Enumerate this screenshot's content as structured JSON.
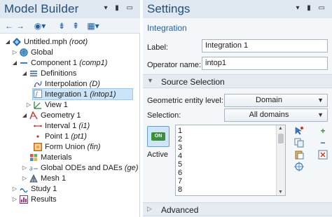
{
  "model_builder": {
    "title": "Model Builder",
    "header_controls": "▾ ▮ ▭",
    "toolbar": {
      "back": "←",
      "forward": "→",
      "show": "◉▾",
      "expand": "⇟",
      "collapse": "⇞",
      "settings": "▦▾"
    },
    "tree": [
      {
        "label": "Untitled.mph",
        "suffix": "(root)"
      },
      {
        "label": "Global",
        "suffix": ""
      },
      {
        "label": "Component 1",
        "suffix": "(comp1)"
      },
      {
        "label": "Definitions",
        "suffix": ""
      },
      {
        "label": "Interpolation",
        "suffix": "(D)"
      },
      {
        "label": "Integration 1",
        "suffix": "(intop1)"
      },
      {
        "label": "View 1",
        "suffix": ""
      },
      {
        "label": "Geometry 1",
        "suffix": ""
      },
      {
        "label": "Interval 1",
        "suffix": "(i1)"
      },
      {
        "label": "Point 1",
        "suffix": "(pt1)"
      },
      {
        "label": "Form Union",
        "suffix": "(fin)"
      },
      {
        "label": "Materials",
        "suffix": ""
      },
      {
        "label": "Global ODEs and DAEs",
        "suffix": "(ge)"
      },
      {
        "label": "Mesh 1",
        "suffix": ""
      },
      {
        "label": "Study 1",
        "suffix": ""
      },
      {
        "label": "Results",
        "suffix": ""
      }
    ]
  },
  "settings": {
    "title": "Settings",
    "header_controls": "▾ ▮ ▭",
    "subtitle": "Integration",
    "label_field": {
      "label": "Label:",
      "value": "Integration 1"
    },
    "operator_field": {
      "label": "Operator name:",
      "value": "intop1"
    },
    "source_section": {
      "title": "Source Selection",
      "arrow": "▼"
    },
    "geometric_level": {
      "label": "Geometric entity level:",
      "value": "Domain",
      "arrow": "▼"
    },
    "selection": {
      "label": "Selection:",
      "value": "All domains",
      "arrow": "▼"
    },
    "active": {
      "label": "Active",
      "toggle": "ON"
    },
    "domains": [
      "1",
      "2",
      "3",
      "4",
      "5",
      "6",
      "7",
      "8"
    ],
    "scrollbar": {
      "up": "▲",
      "down": "▼"
    },
    "side_tools": {
      "plus": "+",
      "minus": "−"
    },
    "advanced_section": {
      "title": "Advanced",
      "arrow": "▷"
    }
  }
}
